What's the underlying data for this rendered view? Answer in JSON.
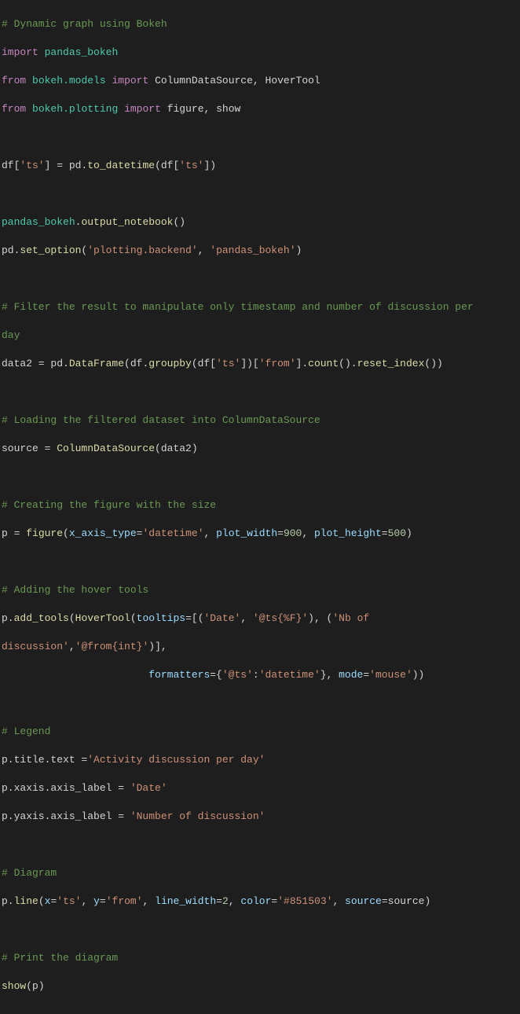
{
  "lines": {
    "l1_comment": "# Dynamic graph using Bokeh",
    "l2_import": "import",
    "l2_mod": "pandas_bokeh",
    "l3_from": "from",
    "l3_mod": "bokeh.models",
    "l3_import": "import",
    "l3_names": "ColumnDataSource, HoverTool",
    "l4_from": "from",
    "l4_mod": "bokeh.plotting",
    "l4_import": "import",
    "l4_names": "figure, show",
    "l6_left": "df[",
    "l6_key": "'ts'",
    "l6_eq": "] = pd.",
    "l6_fn": "to_datetime",
    "l6_open": "(df[",
    "l6_key2": "'ts'",
    "l6_close": "])",
    "l8_mod": "pandas_bokeh",
    "l8_dot": ".",
    "l8_fn": "output_notebook",
    "l8_par": "()",
    "l9_pre": "pd.",
    "l9_fn": "set_option",
    "l9_open": "(",
    "l9_s1": "'plotting.backend'",
    "l9_sep": ", ",
    "l9_s2": "'pandas_bokeh'",
    "l9_close": ")",
    "l11_comment": "# Filter the result to manipulate only timestamp and number of discussion per",
    "l11b_comment": "day",
    "l12_pre": "data2 = pd.",
    "l12_fn1": "DataFrame",
    "l12_open": "(df.",
    "l12_fn2": "groupby",
    "l12_open2": "(df[",
    "l12_s1": "'ts'",
    "l12_mid": "])[",
    "l12_s2": "'from'",
    "l12_mid2": "].",
    "l12_fn3": "count",
    "l12_par": "().",
    "l12_fn4": "reset_index",
    "l12_close": "())",
    "l14_comment": "# Loading the filtered dataset into ColumnDataSource",
    "l15_pre": "source = ",
    "l15_fn": "ColumnDataSource",
    "l15_open": "(data2)",
    "l17_comment": "# Creating the figure with the size",
    "l18_pre": "p = ",
    "l18_fn": "figure",
    "l18_open": "(",
    "l18_k1": "x_axis_type",
    "l18_eq": "=",
    "l18_s1": "'datetime'",
    "l18_sep": ", ",
    "l18_k2": "plot_width",
    "l18_eq2": "=",
    "l18_n1": "900",
    "l18_sep2": ", ",
    "l18_k3": "plot_height",
    "l18_eq3": "=",
    "l18_n2": "500",
    "l18_close": ")",
    "l20_comment": "# Adding the hover tools",
    "l21_pre": "p.",
    "l21_fn": "add_tools",
    "l21_open": "(",
    "l21_fn2": "HoverTool",
    "l21_open2": "(",
    "l21_k1": "tooltips",
    "l21_eq": "=[(",
    "l21_s1": "'Date'",
    "l21_sep": ", ",
    "l21_s2": "'@ts{%F}'",
    "l21_mid": "), (",
    "l21_s3": "'Nb of",
    "l21b_s1": "discussion'",
    "l21b_sep": ",",
    "l21b_s2": "'@from{int}'",
    "l21b_close": ")],",
    "l22_pad": "                        ",
    "l22_k1": "formatters",
    "l22_eq": "={",
    "l22_s1": "'@ts'",
    "l22_sep": ":",
    "l22_s2": "'datetime'",
    "l22_mid": "}, ",
    "l22_k2": "mode",
    "l22_eq2": "=",
    "l22_s3": "'mouse'",
    "l22_close": "))",
    "l24_comment": "# Legend",
    "l25_pre": "p.title.text =",
    "l25_str": "'Activity discussion per day'",
    "l26_pre": "p.xaxis.axis_label = ",
    "l26_str": "'Date'",
    "l27_pre": "p.yaxis.axis_label = ",
    "l27_str": "'Number of discussion'",
    "l29_comment": "# Diagram",
    "l30_pre": "p.",
    "l30_fn": "line",
    "l30_open": "(",
    "l30_k1": "x",
    "l30_eq": "=",
    "l30_s1": "'ts'",
    "l30_sep": ", ",
    "l30_k2": "y",
    "l30_eq2": "=",
    "l30_s2": "'from'",
    "l30_sep2": ", ",
    "l30_k3": "line_width",
    "l30_eq3": "=",
    "l30_n1": "2",
    "l30_sep3": ", ",
    "l30_k4": "color",
    "l30_eq4": "=",
    "l30_s3": "'#851503'",
    "l30_sep4": ", ",
    "l30_k5": "source",
    "l30_eq5": "=source)",
    "l32_comment": "# Print the diagram",
    "l33_fn": "show",
    "l33_arg": "(p)"
  }
}
